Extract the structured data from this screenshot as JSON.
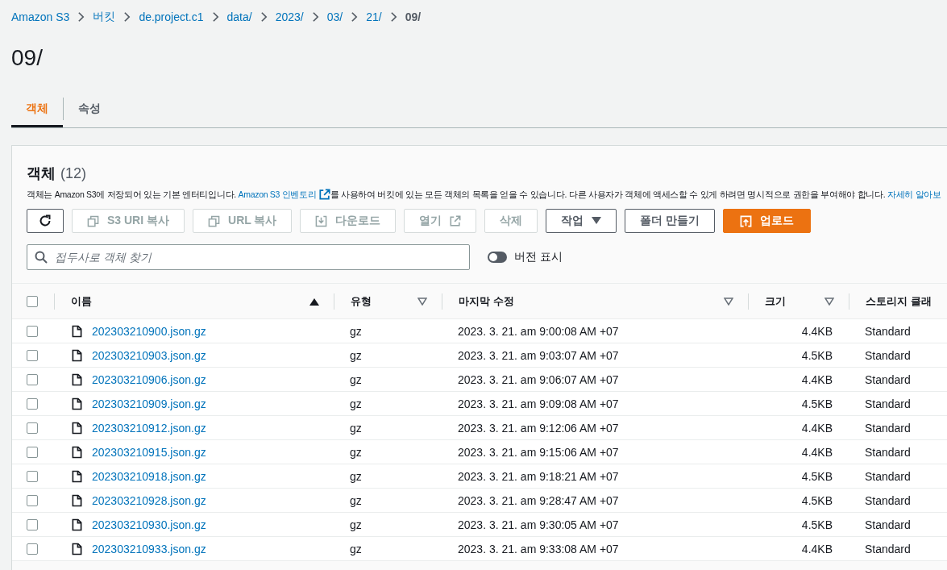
{
  "breadcrumb": [
    {
      "label": "Amazon S3",
      "current": false
    },
    {
      "label": "버킷",
      "current": false
    },
    {
      "label": "de.project.c1",
      "current": false
    },
    {
      "label": "data/",
      "current": false
    },
    {
      "label": "2023/",
      "current": false
    },
    {
      "label": "03/",
      "current": false
    },
    {
      "label": "21/",
      "current": false
    },
    {
      "label": "09/",
      "current": true
    }
  ],
  "title": "09/",
  "tabs": [
    {
      "label": "객체",
      "selected": true
    },
    {
      "label": "속성",
      "selected": false
    }
  ],
  "panel": {
    "title": "객체",
    "count": "(12)",
    "description": [
      {
        "kind": "text",
        "text": "객체는 Amazon S3에 저장되어 있는 기본 엔터티입니다. "
      },
      {
        "kind": "external-link",
        "text": "Amazon S3 인벤토리"
      },
      {
        "kind": "text",
        "text": "를 사용하여 버킷에 있는 모든 객체의 목록을 얻을 수 있습니다. 다른 사용자가 객체에 액세스할 수 있게 하려면 명시적으로 권한을 부여해야 합니다. "
      },
      {
        "kind": "link",
        "text": "자세히 알아보"
      }
    ],
    "buttons": [
      {
        "kind": "refresh",
        "disabled": false
      },
      {
        "kind": "copy",
        "label": "S3 URI 복사",
        "disabled": true
      },
      {
        "kind": "copy",
        "label": "URL 복사",
        "disabled": true
      },
      {
        "kind": "download",
        "label": "다운로드",
        "disabled": true
      },
      {
        "kind": "open",
        "label": "열기",
        "disabled": true
      },
      {
        "kind": "plain",
        "label": "삭제",
        "disabled": true
      },
      {
        "kind": "dropdown",
        "label": "작업",
        "disabled": false
      },
      {
        "kind": "plain",
        "label": "폴더 만들기",
        "disabled": false
      },
      {
        "kind": "upload",
        "label": "업로드",
        "disabled": false
      }
    ],
    "search": {
      "placeholder": "접두사로 객체 찾기"
    },
    "toggle": {
      "label": "버전 표시",
      "on": false
    },
    "table": {
      "select_all_checked": false,
      "columns": [
        {
          "label": "이름",
          "sorted": true
        },
        {
          "label": "유형",
          "sorted": false
        },
        {
          "label": "마지막 수정",
          "sorted": false
        },
        {
          "label": "크기",
          "sorted": false
        },
        {
          "label": "스토리지 클래"
        }
      ],
      "rows": [
        {
          "checked": false,
          "name": "202303210900.json.gz",
          "type": "gz",
          "modified": "2023. 3. 21. am 9:00:08 AM +07",
          "size": "4.4KB",
          "storage_class": "Standard"
        },
        {
          "checked": false,
          "name": "202303210903.json.gz",
          "type": "gz",
          "modified": "2023. 3. 21. am 9:03:07 AM +07",
          "size": "4.5KB",
          "storage_class": "Standard"
        },
        {
          "checked": false,
          "name": "202303210906.json.gz",
          "type": "gz",
          "modified": "2023. 3. 21. am 9:06:07 AM +07",
          "size": "4.4KB",
          "storage_class": "Standard"
        },
        {
          "checked": false,
          "name": "202303210909.json.gz",
          "type": "gz",
          "modified": "2023. 3. 21. am 9:09:08 AM +07",
          "size": "4.5KB",
          "storage_class": "Standard"
        },
        {
          "checked": false,
          "name": "202303210912.json.gz",
          "type": "gz",
          "modified": "2023. 3. 21. am 9:12:06 AM +07",
          "size": "4.4KB",
          "storage_class": "Standard"
        },
        {
          "checked": false,
          "name": "202303210915.json.gz",
          "type": "gz",
          "modified": "2023. 3. 21. am 9:15:06 AM +07",
          "size": "4.4KB",
          "storage_class": "Standard"
        },
        {
          "checked": false,
          "name": "202303210918.json.gz",
          "type": "gz",
          "modified": "2023. 3. 21. am 9:18:21 AM +07",
          "size": "4.5KB",
          "storage_class": "Standard"
        },
        {
          "checked": false,
          "name": "202303210928.json.gz",
          "type": "gz",
          "modified": "2023. 3. 21. am 9:28:47 AM +07",
          "size": "4.5KB",
          "storage_class": "Standard"
        },
        {
          "checked": false,
          "name": "202303210930.json.gz",
          "type": "gz",
          "modified": "2023. 3. 21. am 9:30:05 AM +07",
          "size": "4.5KB",
          "storage_class": "Standard"
        },
        {
          "checked": false,
          "name": "202303210933.json.gz",
          "type": "gz",
          "modified": "2023. 3. 21. am 9:33:08 AM +07",
          "size": "4.4KB",
          "storage_class": "Standard"
        }
      ]
    }
  }
}
